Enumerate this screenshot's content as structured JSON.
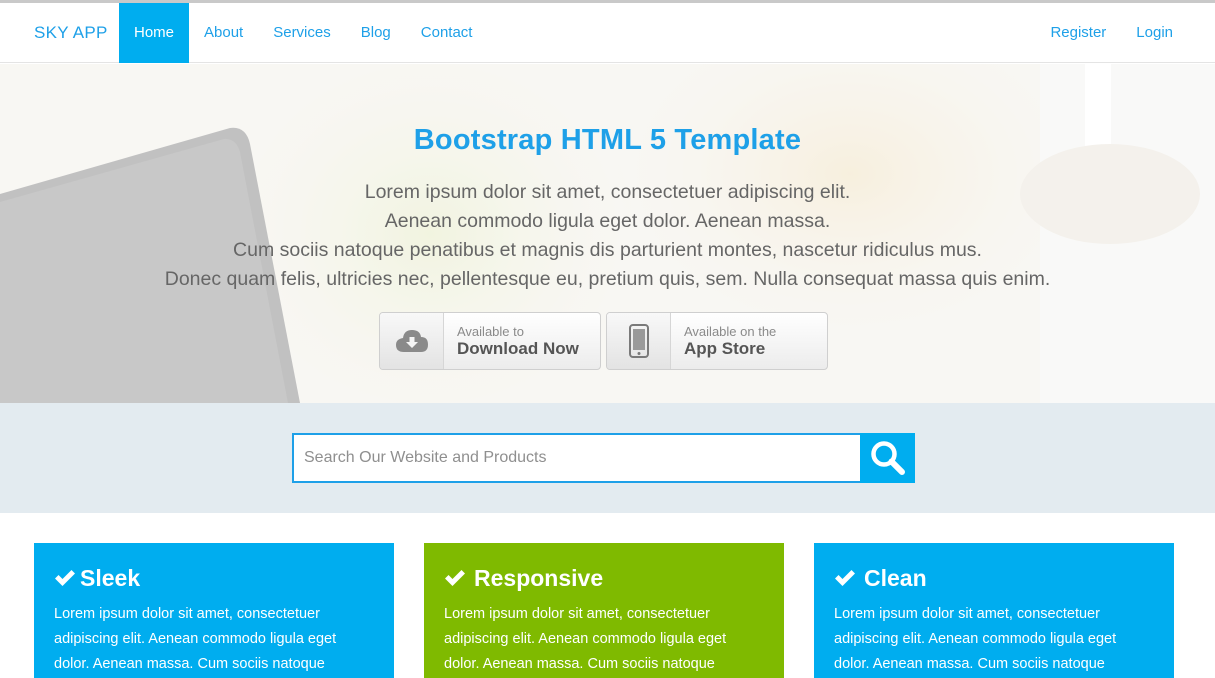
{
  "navbar": {
    "brand": "SKY APP",
    "left_items": [
      {
        "label": "Home",
        "active": true
      },
      {
        "label": "About"
      },
      {
        "label": "Services"
      },
      {
        "label": "Blog"
      },
      {
        "label": "Contact"
      }
    ],
    "right_items": [
      {
        "label": "Register"
      },
      {
        "label": "Login"
      }
    ]
  },
  "hero": {
    "title": "Bootstrap HTML 5 Template",
    "lines": [
      "Lorem ipsum dolor sit amet, consectetuer adipiscing elit.",
      "Aenean commodo ligula eget dolor. Aenean massa.",
      "Cum sociis natoque penatibus et magnis dis parturient montes, nascetur ridiculus mus.",
      "Donec quam felis, ultricies nec, pellentesque eu, pretium quis, sem. Nulla consequat massa quis enim."
    ],
    "download_button": {
      "small": "Available to",
      "big": "Download Now",
      "icon": "cloud-download-icon"
    },
    "appstore_button": {
      "small": "Available on the",
      "big": "App Store",
      "icon": "smartphone-icon"
    }
  },
  "search": {
    "placeholder": "Search Our Website and Products",
    "value": "",
    "icon": "search-icon"
  },
  "features": [
    {
      "title": "Sleek",
      "text": "Lorem ipsum dolor sit amet, consectetuer adipiscing elit. Aenean commodo ligula eget dolor. Aenean massa. Cum sociis natoque",
      "color": "#00adef"
    },
    {
      "title": "Responsive",
      "text": "Lorem ipsum dolor sit amet, consectetuer adipiscing elit. Aenean commodo ligula eget dolor. Aenean massa. Cum sociis natoque",
      "color": "#7fba00"
    },
    {
      "title": "Clean",
      "text": "Lorem ipsum dolor sit amet, consectetuer adipiscing elit. Aenean commodo ligula eget dolor. Aenean massa. Cum sociis natoque",
      "color": "#00adef"
    }
  ],
  "colors": {
    "accent": "#00adef",
    "link": "#1ea0e8",
    "green": "#7fba00",
    "band": "#e3ebf0"
  }
}
